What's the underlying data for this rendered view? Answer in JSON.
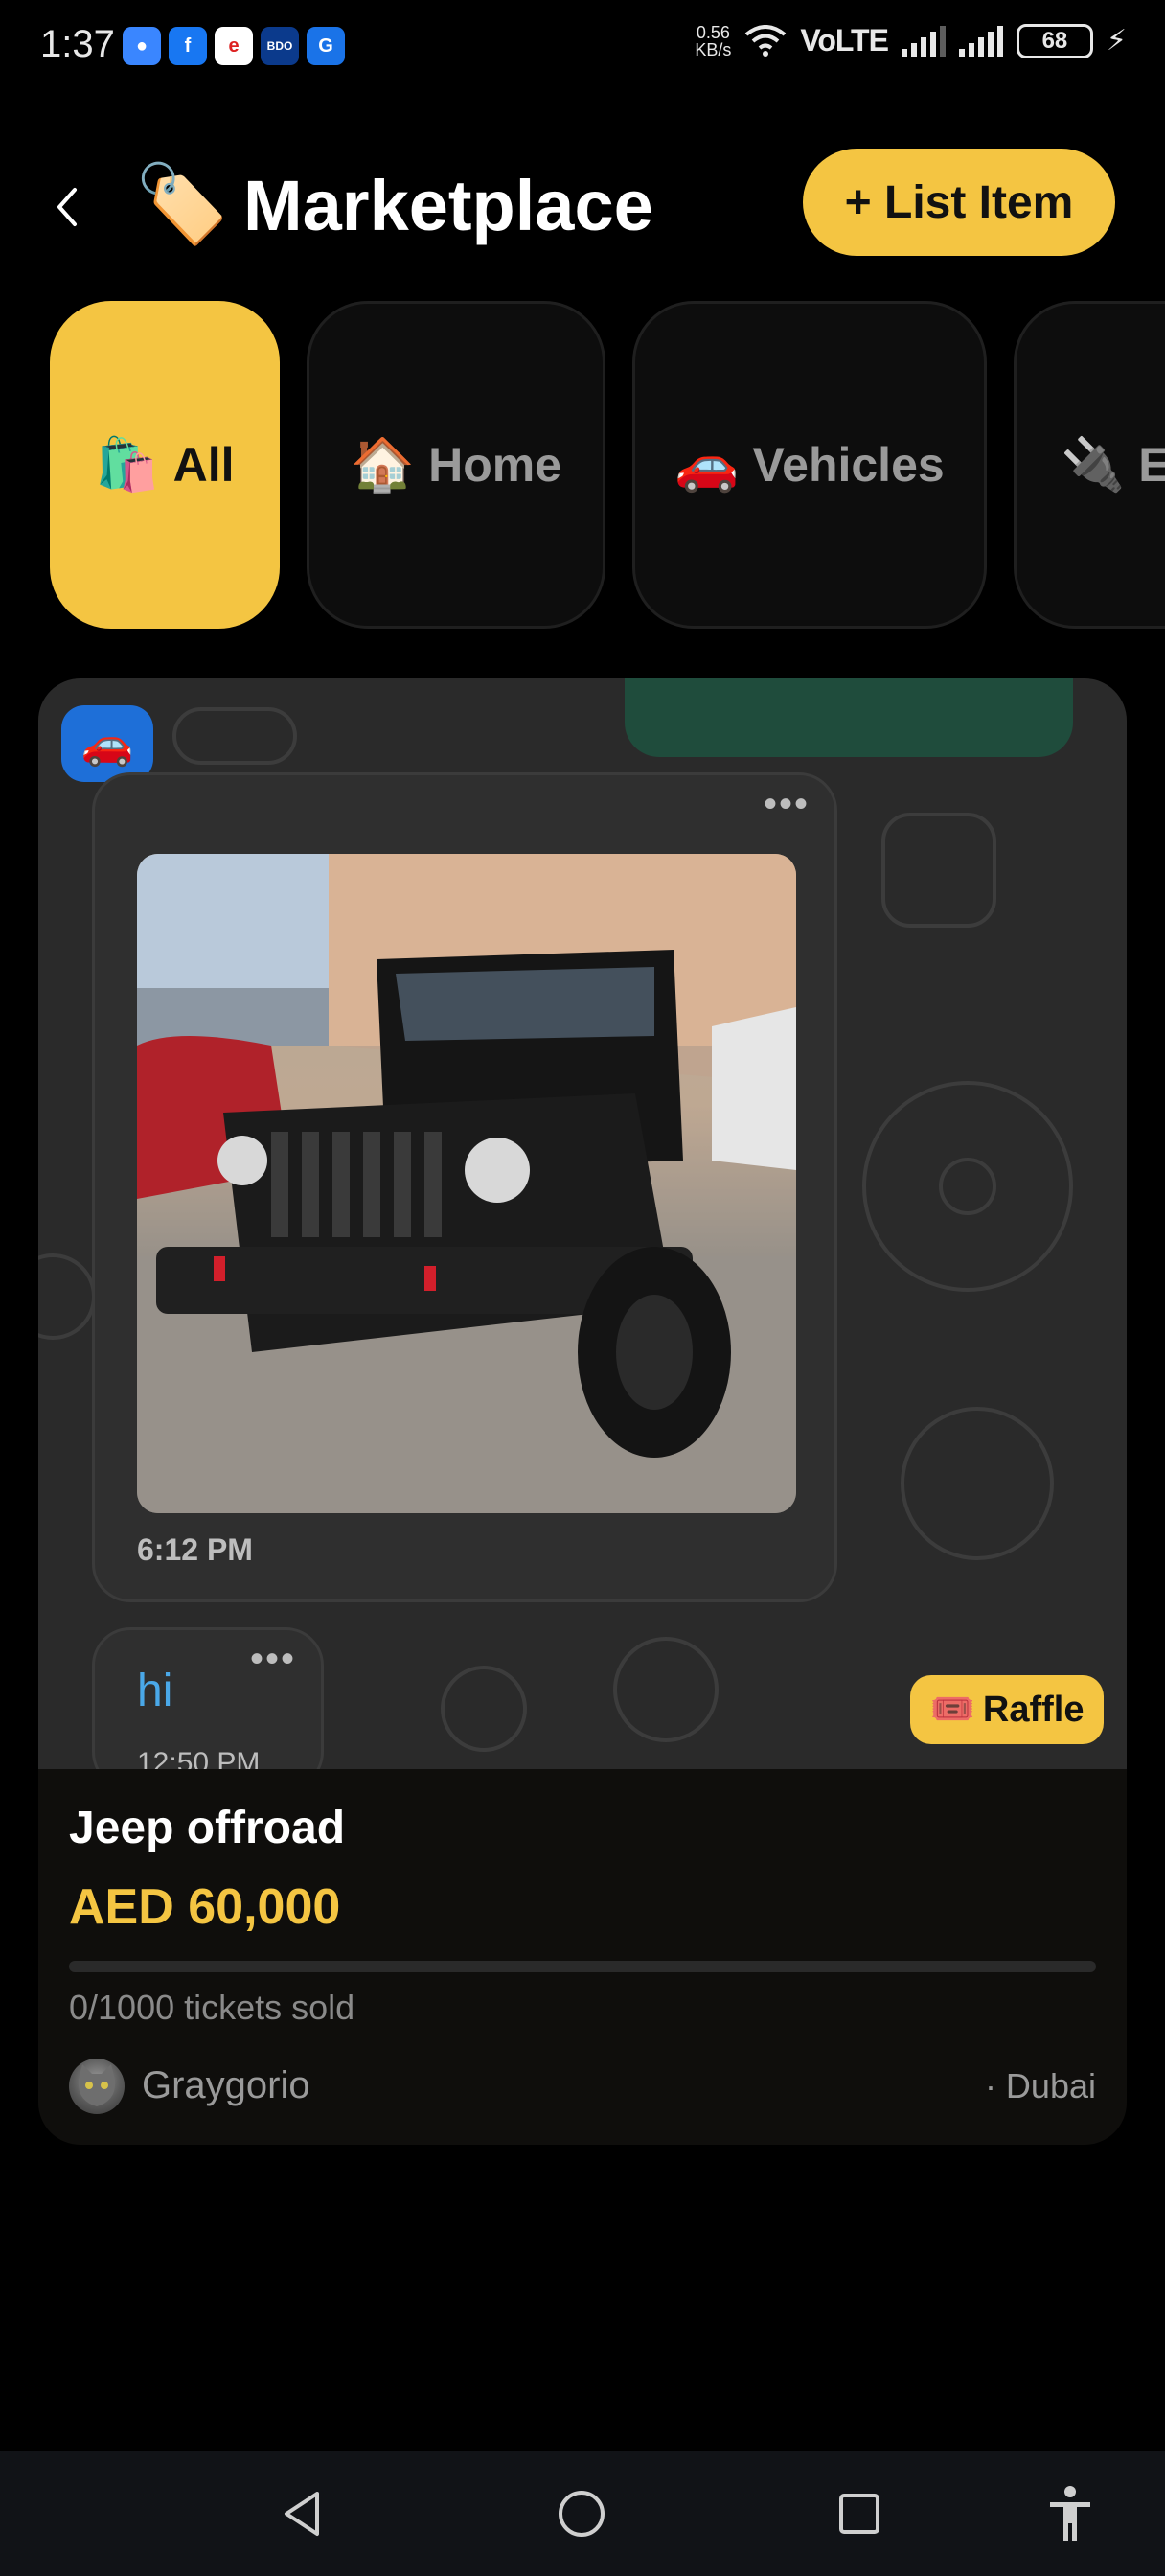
{
  "status_bar": {
    "time": "1:37",
    "net_speed_value": "0.56",
    "net_speed_unit": "KB/s",
    "volte": "VoLTE",
    "battery": "68"
  },
  "header": {
    "title": "Marketplace",
    "title_icon": "🏷️",
    "list_button": "+ List Item"
  },
  "categories": [
    {
      "icon": "🛍️",
      "label": "All",
      "active": true
    },
    {
      "icon": "🏠",
      "label": "Home",
      "active": false
    },
    {
      "icon": "🚗",
      "label": "Vehicles",
      "active": false
    },
    {
      "icon": "🔌",
      "label": "E",
      "active": false
    }
  ],
  "listing": {
    "category_badge_icon": "🚗",
    "chat_bubble_time": "6:12 PM",
    "chat_bubble2_text": "hi",
    "chat_bubble2_time": "12:50 PM",
    "raffle_badge_icon": "🎟️",
    "raffle_badge_label": "Raffle",
    "title": "Jeep offroad",
    "price": "AED 60,000",
    "tickets_progress": 0,
    "tickets_text": "0/1000 tickets sold",
    "seller": "Graygorio",
    "location": "· Dubai"
  },
  "colors": {
    "accent": "#f4c542",
    "background": "#000000",
    "card": "#0f0e0c",
    "badge_blue": "#1e6fd8"
  }
}
